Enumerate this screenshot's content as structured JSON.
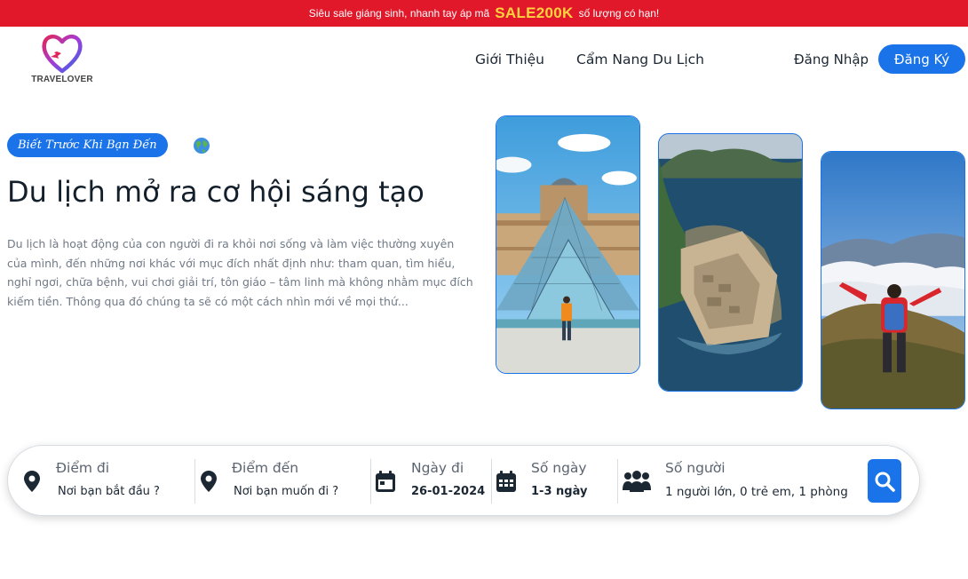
{
  "promo": {
    "text_before": "Siêu sale giáng sinh, nhanh tay áp mã",
    "code": "SALE200K",
    "text_after": "số lượng có hạn!"
  },
  "brand": {
    "name": "TRAVELOVER",
    "primary_color": "#1a73e8",
    "promo_color": "#e0182a"
  },
  "nav": {
    "items": [
      "Giới Thiệu",
      "Cẩm Nang Du Lịch"
    ],
    "login": "Đăng Nhập",
    "signup": "Đăng Ký"
  },
  "hero": {
    "badge": "Biết Trước Khi Bạn Đến",
    "title": "Du lịch mở ra cơ hội sáng tạo",
    "description": "Du lịch là hoạt động của con người đi ra khỏi nơi sống và làm việc thường xuyên của mình, đến những nơi khác với mục đích nhất định như: tham quan, tìm hiểu, nghỉ ngơi, chữa bệnh, vui chơi giải trí, tôn giáo – tâm linh mà không nhằm mục đích kiếm tiền. Thông qua đó chúng ta sẽ có một cách nhìn mới về mọi thứ..."
  },
  "search": {
    "from": {
      "label": "Điểm đi",
      "value": "Nơi bạn bắt đầu ?"
    },
    "to": {
      "label": "Điểm đến",
      "value": "Nơi bạn muốn đi ?"
    },
    "date": {
      "label": "Ngày đi",
      "value": "26-01-2024"
    },
    "days": {
      "label": "Số ngày",
      "value": "1-3 ngày"
    },
    "people": {
      "label": "Số người",
      "value": "1 người lớn, 0 trẻ em, 1 phòng"
    }
  }
}
